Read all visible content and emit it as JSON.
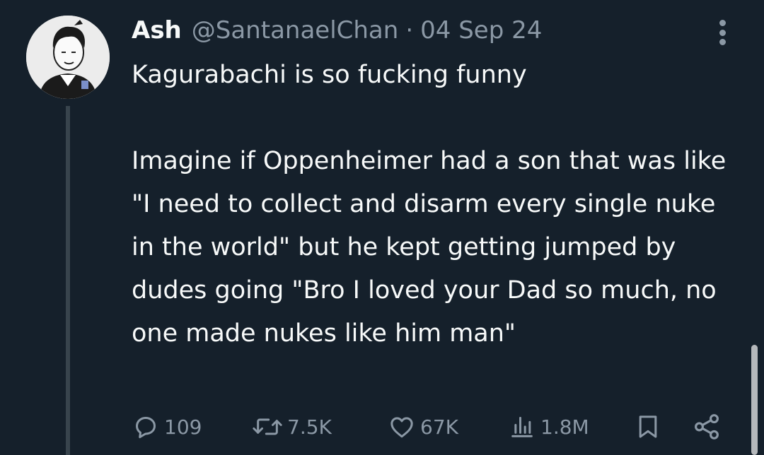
{
  "tweet": {
    "author": {
      "display_name": "Ash",
      "handle": "@SantanaelChan",
      "separator": "·",
      "date": "04 Sep 24"
    },
    "text": "Kagurabachi is so fucking funny\n\nImagine if Oppenheimer had a son that was like \"I need to collect and disarm every single nuke in the world\" but he kept getting jumped by dudes going \"Bro I loved your Dad so much, no one made nukes like him man\"",
    "stats": {
      "replies": "109",
      "reposts": "7.5K",
      "likes": "67K",
      "views": "1.8M"
    }
  },
  "icons": {
    "more": "more-vertical-icon",
    "reply": "reply-icon",
    "repost": "repost-icon",
    "like": "heart-icon",
    "views": "views-icon",
    "bookmark": "bookmark-icon",
    "share": "share-icon"
  },
  "colors": {
    "background": "#15202b",
    "text_primary": "#f7f9f9",
    "text_secondary": "#8b98a5",
    "thread_line": "#38444d"
  }
}
